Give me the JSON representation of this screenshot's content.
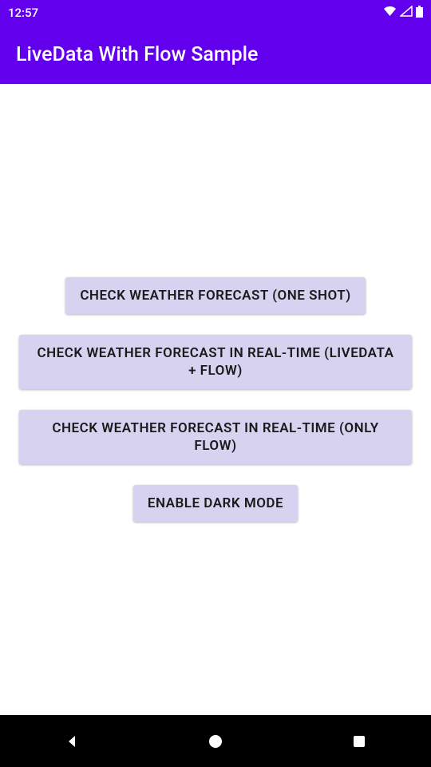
{
  "statusBar": {
    "time": "12:57"
  },
  "appBar": {
    "title": "LiveData With Flow Sample"
  },
  "buttons": {
    "oneShot": "CHECK WEATHER FORECAST (ONE SHOT)",
    "livedataFlow": "CHECK WEATHER FORECAST IN REAL-TIME (LIVEDATA + FLOW)",
    "onlyFlow": "CHECK WEATHER FORECAST IN REAL-TIME (ONLY FLOW)",
    "darkMode": "ENABLE DARK MODE"
  }
}
